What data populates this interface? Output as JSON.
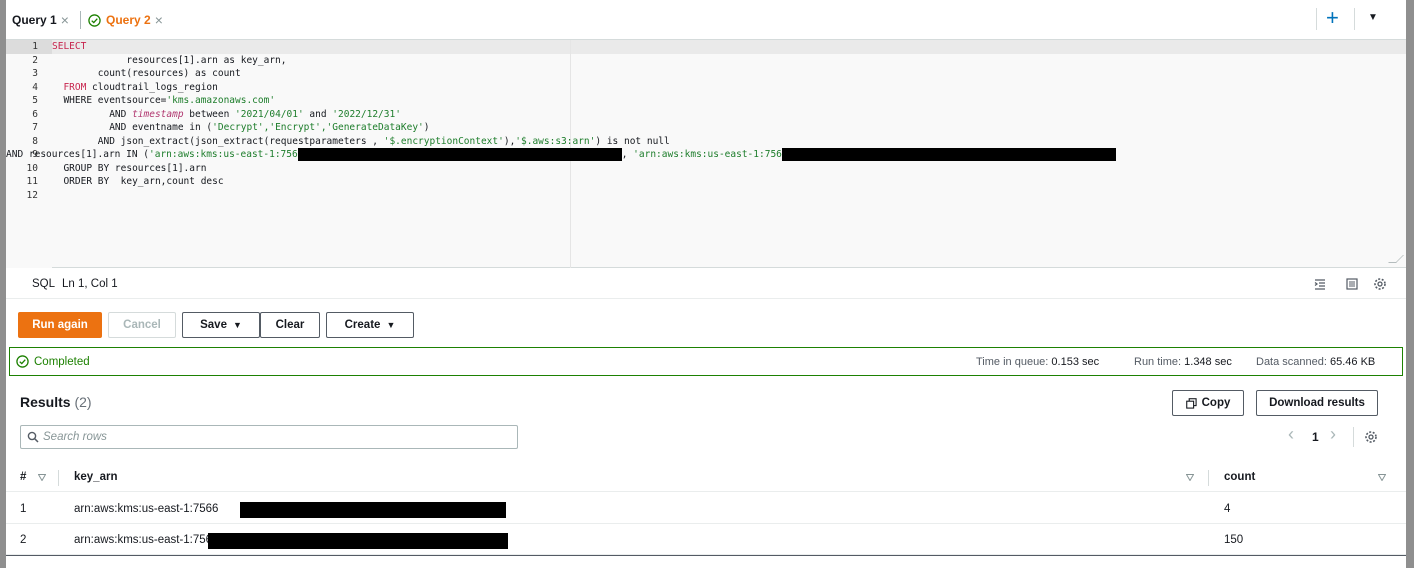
{
  "tabs": [
    {
      "label": "Query 1",
      "close": "×"
    },
    {
      "label": "Query 2",
      "close": "×"
    }
  ],
  "toolbar": {
    "add_label": "+",
    "menu_caret": "▼"
  },
  "editor": {
    "lines": [
      {
        "num": "1"
      },
      {
        "num": "2"
      },
      {
        "num": "3"
      },
      {
        "num": "4"
      },
      {
        "num": "5"
      },
      {
        "num": "6"
      },
      {
        "num": "7"
      },
      {
        "num": "8"
      },
      {
        "num": "9"
      },
      {
        "num": "10"
      },
      {
        "num": "11"
      },
      {
        "num": "12"
      }
    ],
    "code": {
      "l1": "SELECT",
      "l2": "             resources[1].arn as key_arn,",
      "l3": "        count(resources) as count",
      "l4_kw": "  FROM",
      "l4_rest": " cloudtrail_logs_region",
      "l5_a": "  WHERE eventsource=",
      "l5_s": "'kms.amazonaws.com'",
      "l6_a": "          AND ",
      "l6_i": "timestamp",
      "l6_b": " between ",
      "l6_s1": "'2021/04/01'",
      "l6_c": " and ",
      "l6_s2": "'2022/12/31'",
      "l7_a": "          AND eventname in (",
      "l7_s": "'Decrypt','Encrypt','GenerateDataKey'",
      "l7_b": ")",
      "l8_a": "        AND json_extract(json_extract(requestparameters , ",
      "l8_s1": "'$.encryptionContext'",
      "l8_b": "),",
      "l8_s2": "'$.aws:s3:arn'",
      "l8_c": ") is not null",
      "l9_a": "AND resources[1].arn IN (",
      "l9_s1": "'arn:aws:kms:us-east-1:756",
      "l9_b": ", ",
      "l9_s2": "'arn:aws:kms:us-east-1:756",
      "l10": "  GROUP BY resources[1].arn",
      "l11": "  ORDER BY  key_arn,count desc"
    }
  },
  "status": {
    "language": "SQL",
    "cursor": "Ln 1, Col 1"
  },
  "buttons": {
    "run_again": "Run again",
    "cancel": "Cancel",
    "save": "Save",
    "clear": "Clear",
    "create": "Create",
    "caret": "▼"
  },
  "completion": {
    "label": "Completed",
    "queue_label": "Time in queue:",
    "queue_value": "0.153 sec",
    "run_label": "Run time:",
    "run_value": "1.348 sec",
    "scanned_label": "Data scanned:",
    "scanned_value": "65.46 KB"
  },
  "results": {
    "title": "Results",
    "count": "(2)",
    "copy_label": "Copy",
    "download_label": "Download results",
    "search_placeholder": "Search rows",
    "page": "1",
    "prev": "‹",
    "next": "›",
    "columns": {
      "index": "#",
      "key_arn": "key_arn",
      "count": "count"
    },
    "rows": [
      {
        "index": "1",
        "key_arn": "arn:aws:kms:us-east-1:7566",
        "count": "4"
      },
      {
        "index": "2",
        "key_arn": "arn:aws:kms:us-east-1:7566",
        "count": "150"
      }
    ]
  },
  "colors": {
    "accent_orange": "#ec7211",
    "success_green": "#1d8102",
    "link_blue": "#0073bb"
  }
}
